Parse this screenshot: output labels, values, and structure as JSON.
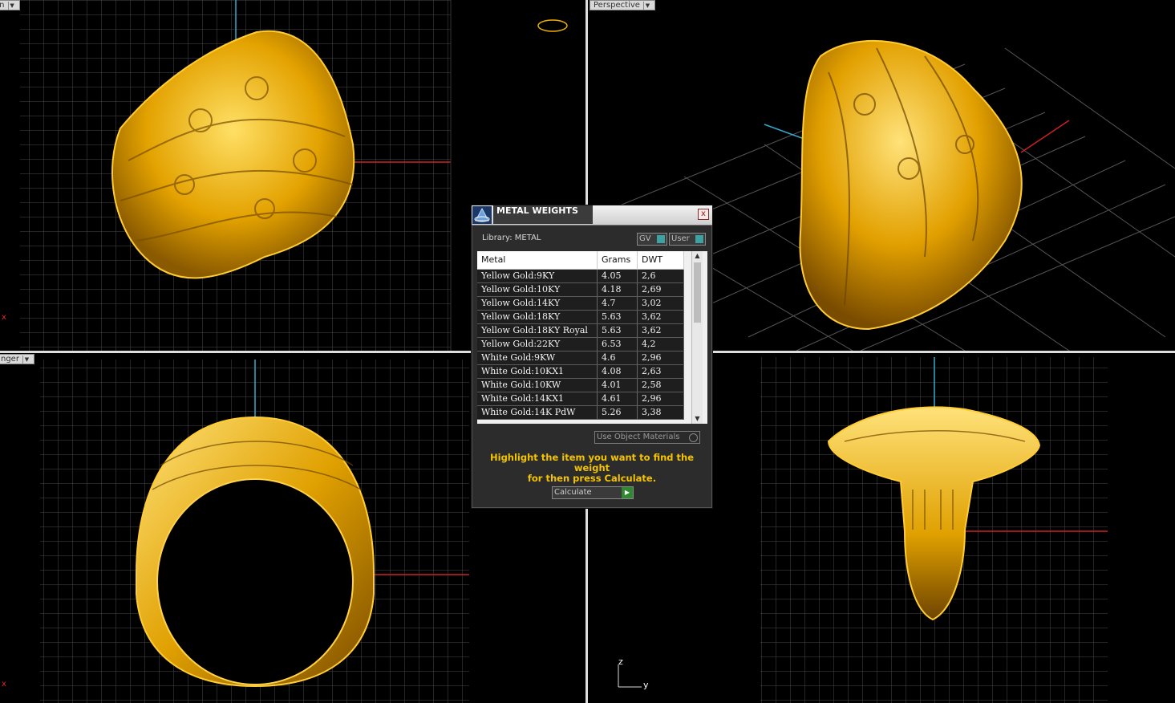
{
  "viewports": {
    "top_left": {
      "label": "wn"
    },
    "top_right": {
      "label": "Perspective"
    },
    "bottom_left": {
      "label": "nger"
    }
  },
  "axes": {
    "z": "z",
    "y": "y",
    "x_marker": "x"
  },
  "dialog": {
    "title": "METAL WEIGHTS",
    "close": "x",
    "library_label": "Library: METAL",
    "gv_button": "GV",
    "user_button": "User",
    "columns": [
      "Metal",
      "Grams",
      "DWT"
    ],
    "rows": [
      {
        "metal": "Yellow Gold:9KY",
        "grams": "4.05",
        "dwt": "2,6"
      },
      {
        "metal": "Yellow Gold:10KY",
        "grams": "4.18",
        "dwt": "2,69"
      },
      {
        "metal": "Yellow Gold:14KY",
        "grams": "4.7",
        "dwt": "3,02"
      },
      {
        "metal": "Yellow Gold:18KY",
        "grams": "5.63",
        "dwt": "3,62"
      },
      {
        "metal": "Yellow Gold:18KY Royal",
        "grams": "5.63",
        "dwt": "3,62"
      },
      {
        "metal": "Yellow Gold:22KY",
        "grams": "6.53",
        "dwt": "4,2"
      },
      {
        "metal": "White Gold:9KW",
        "grams": "4.6",
        "dwt": "2,96"
      },
      {
        "metal": "White Gold:10KX1",
        "grams": "4.08",
        "dwt": "2,63"
      },
      {
        "metal": "White Gold:10KW",
        "grams": "4.01",
        "dwt": "2,58"
      },
      {
        "metal": "White Gold:14KX1",
        "grams": "4.61",
        "dwt": "2,96"
      },
      {
        "metal": "White Gold:14K PdW",
        "grams": "5.26",
        "dwt": "3,38"
      }
    ],
    "use_object_materials": "Use Object Materials",
    "hint_line1": "Highlight the item you want to find the weight",
    "hint_line2": "for then press Calculate.",
    "calculate": "Calculate"
  },
  "colors": {
    "gold": "#f0b000",
    "grid": "#555555",
    "axis_red": "#cc2222",
    "axis_cyan": "#33aacc",
    "hint": "#f4c400"
  }
}
